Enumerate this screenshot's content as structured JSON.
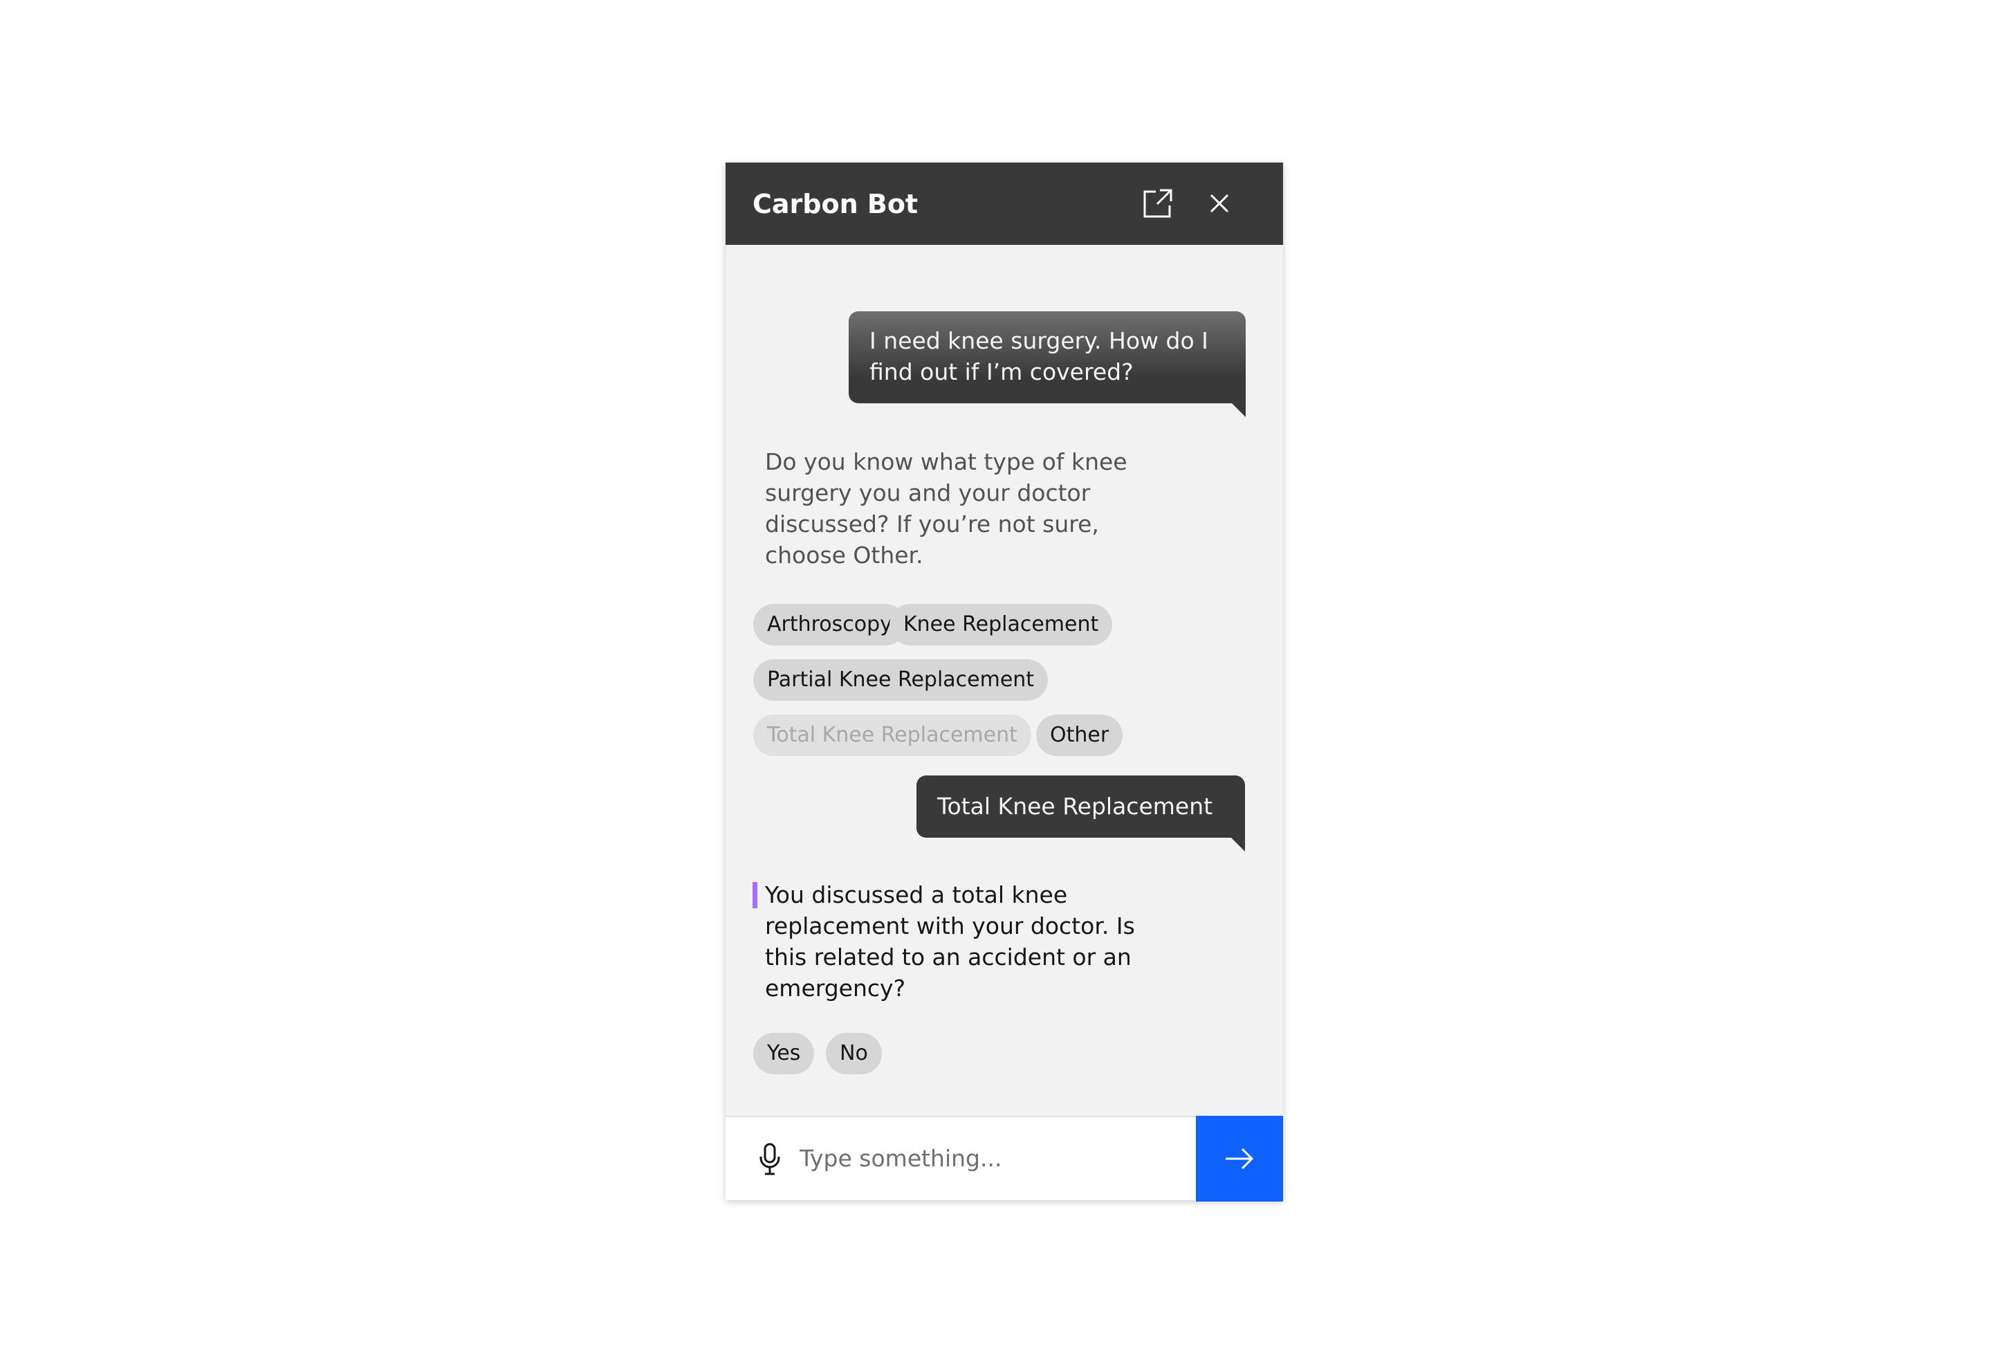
{
  "header": {
    "title": "Carbon Bot",
    "popout_icon": "launch-icon",
    "close_icon": "close-icon"
  },
  "messages": {
    "user_1": "I need knee surgery. How do I find out if I’m covered?",
    "bot_1": "Do you know what type of knee surgery you and your doctor discussed? If you’re not sure, choose Other.",
    "options_1": [
      "Arthroscopy",
      "Knee Replacement",
      "Partial Knee Replacement",
      "Total Knee Replacement",
      "Other"
    ],
    "options_1_selected": "Total Knee Replacement",
    "user_2": "Total Knee Replacement",
    "bot_2": "You discussed a total knee replacement with your doctor. Is this related to an accident or an emergency?",
    "options_2": [
      "Yes",
      "No"
    ]
  },
  "input": {
    "placeholder": "Type something...",
    "value": "",
    "mic_icon": "microphone-icon",
    "send_icon": "arrow-right-icon"
  },
  "colors": {
    "header_bg": "#393939",
    "chat_bg": "#f2f2f2",
    "user_bubble": "#393939",
    "chip_bg": "#d6d6d6",
    "send_button": "#0f62fe",
    "accent_bar": "#a56eff"
  }
}
